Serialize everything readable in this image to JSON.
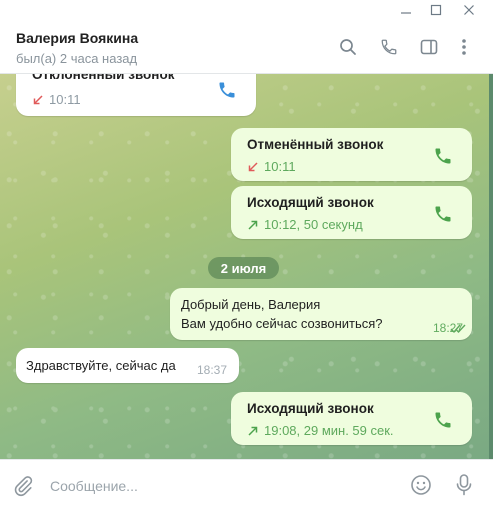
{
  "window": {
    "controls": [
      "minimize-icon",
      "maximize-icon",
      "close-icon"
    ]
  },
  "header": {
    "contact_name": "Валерия Воякина",
    "status": "был(а) 2 часа назад",
    "icons": [
      "search-icon",
      "phone-icon",
      "side-panel-icon",
      "more-vertical-icon"
    ]
  },
  "messages": {
    "call_declined": {
      "title": "Отклонённый звонок",
      "meta": "10:11",
      "direction": "incoming-missed"
    },
    "call_cancelled": {
      "title": "Отменённый звонок",
      "meta": "10:11",
      "direction": "outgoing-missed"
    },
    "call_outgoing_1": {
      "title": "Исходящий звонок",
      "meta": "10:12, 50 секунд",
      "direction": "outgoing"
    },
    "date_separator": "2 июля",
    "text_out": {
      "line1": "Добрый день, Валерия",
      "line2": "Вам удобно сейчас созвониться?",
      "time": "18:27",
      "status": "read"
    },
    "text_in": {
      "text": "Здравствуйте, сейчас да",
      "time": "18:37"
    },
    "call_outgoing_2": {
      "title": "Исходящий звонок",
      "meta": "19:08, 29 мин. 59 сек.",
      "direction": "outgoing"
    }
  },
  "composer": {
    "placeholder": "Сообщение...",
    "icons": [
      "attach-icon",
      "emoji-icon",
      "microphone-icon"
    ]
  },
  "colors": {
    "accent": "#4ca34c",
    "missed_arrow": "#e05a5a",
    "outgoing_bubble": "#effdde",
    "incoming_bubble": "#ffffff",
    "call_icon_incoming": "#3a8fd9",
    "call_icon_outgoing": "#4ca34c"
  }
}
